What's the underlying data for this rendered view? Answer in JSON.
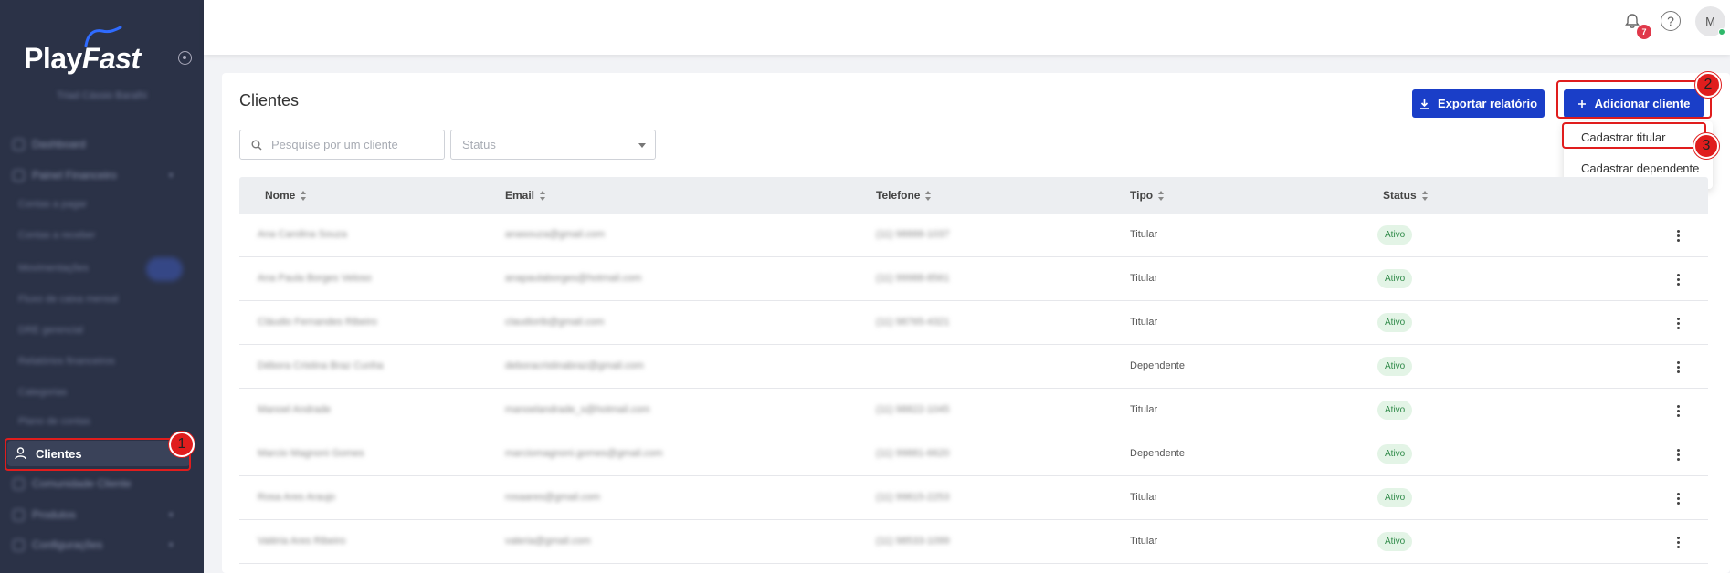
{
  "sidebar": {
    "logo_main": "Play",
    "logo_accent": "Fast",
    "company": "Triad Cássio Baralhi",
    "items": [
      {
        "label": "Dashboard",
        "level": 0
      },
      {
        "label": "Painel Financeiro",
        "level": 0
      },
      {
        "label": "Contas a pagar",
        "level": 1
      },
      {
        "label": "Contas a receber",
        "level": 1
      },
      {
        "label": "Movimentações",
        "level": 1
      },
      {
        "label": "Fluxo de caixa mensal",
        "level": 1
      },
      {
        "label": "DRE gerencial",
        "level": 1
      },
      {
        "label": "Relatórios financeiros",
        "level": 1
      },
      {
        "label": "Categorias",
        "level": 1
      },
      {
        "label": "Plano de contas",
        "level": 1
      }
    ],
    "active_item": "Clientes",
    "bottom_items": [
      {
        "label": "Comunidade Cliente"
      },
      {
        "label": "Produtos"
      },
      {
        "label": "Configurações"
      }
    ]
  },
  "topbar": {
    "notification_count": "7",
    "help_glyph": "?",
    "avatar_initial": "M"
  },
  "page": {
    "title": "Clientes",
    "search_placeholder": "Pesquise por um cliente",
    "status_placeholder": "Status",
    "export_label": "Exportar relatório",
    "add_label": "Adicionar cliente"
  },
  "dropdown": {
    "items": [
      "Cadastrar titular",
      "Cadastrar dependente"
    ]
  },
  "markers": [
    "1",
    "2",
    "3"
  ],
  "table": {
    "columns": [
      "Nome",
      "Email",
      "Telefone",
      "Tipo",
      "Status"
    ],
    "rows": [
      {
        "name": "Ana Carolina Souza",
        "email": "anasouza@gmail.com",
        "phone": "(11) 98888-1037",
        "type": "Titular",
        "status": "Ativo"
      },
      {
        "name": "Ana Paula Borges Veloso",
        "email": "anapaulaborges@hotmail.com",
        "phone": "(11) 99988-8561",
        "type": "Titular",
        "status": "Ativo"
      },
      {
        "name": "Cláudio Fernandes Ribeiro",
        "email": "claudiorib@gmail.com",
        "phone": "(11) 98765-4321",
        "type": "Titular",
        "status": "Ativo"
      },
      {
        "name": "Débora Cristina Braz Cunha",
        "email": "deboracristinabraz@gmail.com",
        "phone": "",
        "type": "Dependente",
        "status": "Ativo"
      },
      {
        "name": "Manoel Andrade",
        "email": "manoelandrade_s@hotmail.com",
        "phone": "(11) 98822-1045",
        "type": "Titular",
        "status": "Ativo"
      },
      {
        "name": "Marcio Magnoni Gomes",
        "email": "marciomagnoni.gomes@gmail.com",
        "phone": "(11) 99881-6620",
        "type": "Dependente",
        "status": "Ativo"
      },
      {
        "name": "Rosa Ares Araujo",
        "email": "rosaares@gmail.com",
        "phone": "(11) 99815-2253",
        "type": "Titular",
        "status": "Ativo"
      },
      {
        "name": "Valéria Ares Ribeiro",
        "email": "valeria@gmail.com",
        "phone": "(11) 98533-1099",
        "type": "Titular",
        "status": "Ativo"
      }
    ]
  },
  "colors": {
    "sidebar_bg": "#2b3247",
    "primary": "#1a3ec8",
    "highlight": "#e01d1d",
    "status_bg": "#e3f4e6",
    "status_fg": "#2f8a48"
  }
}
